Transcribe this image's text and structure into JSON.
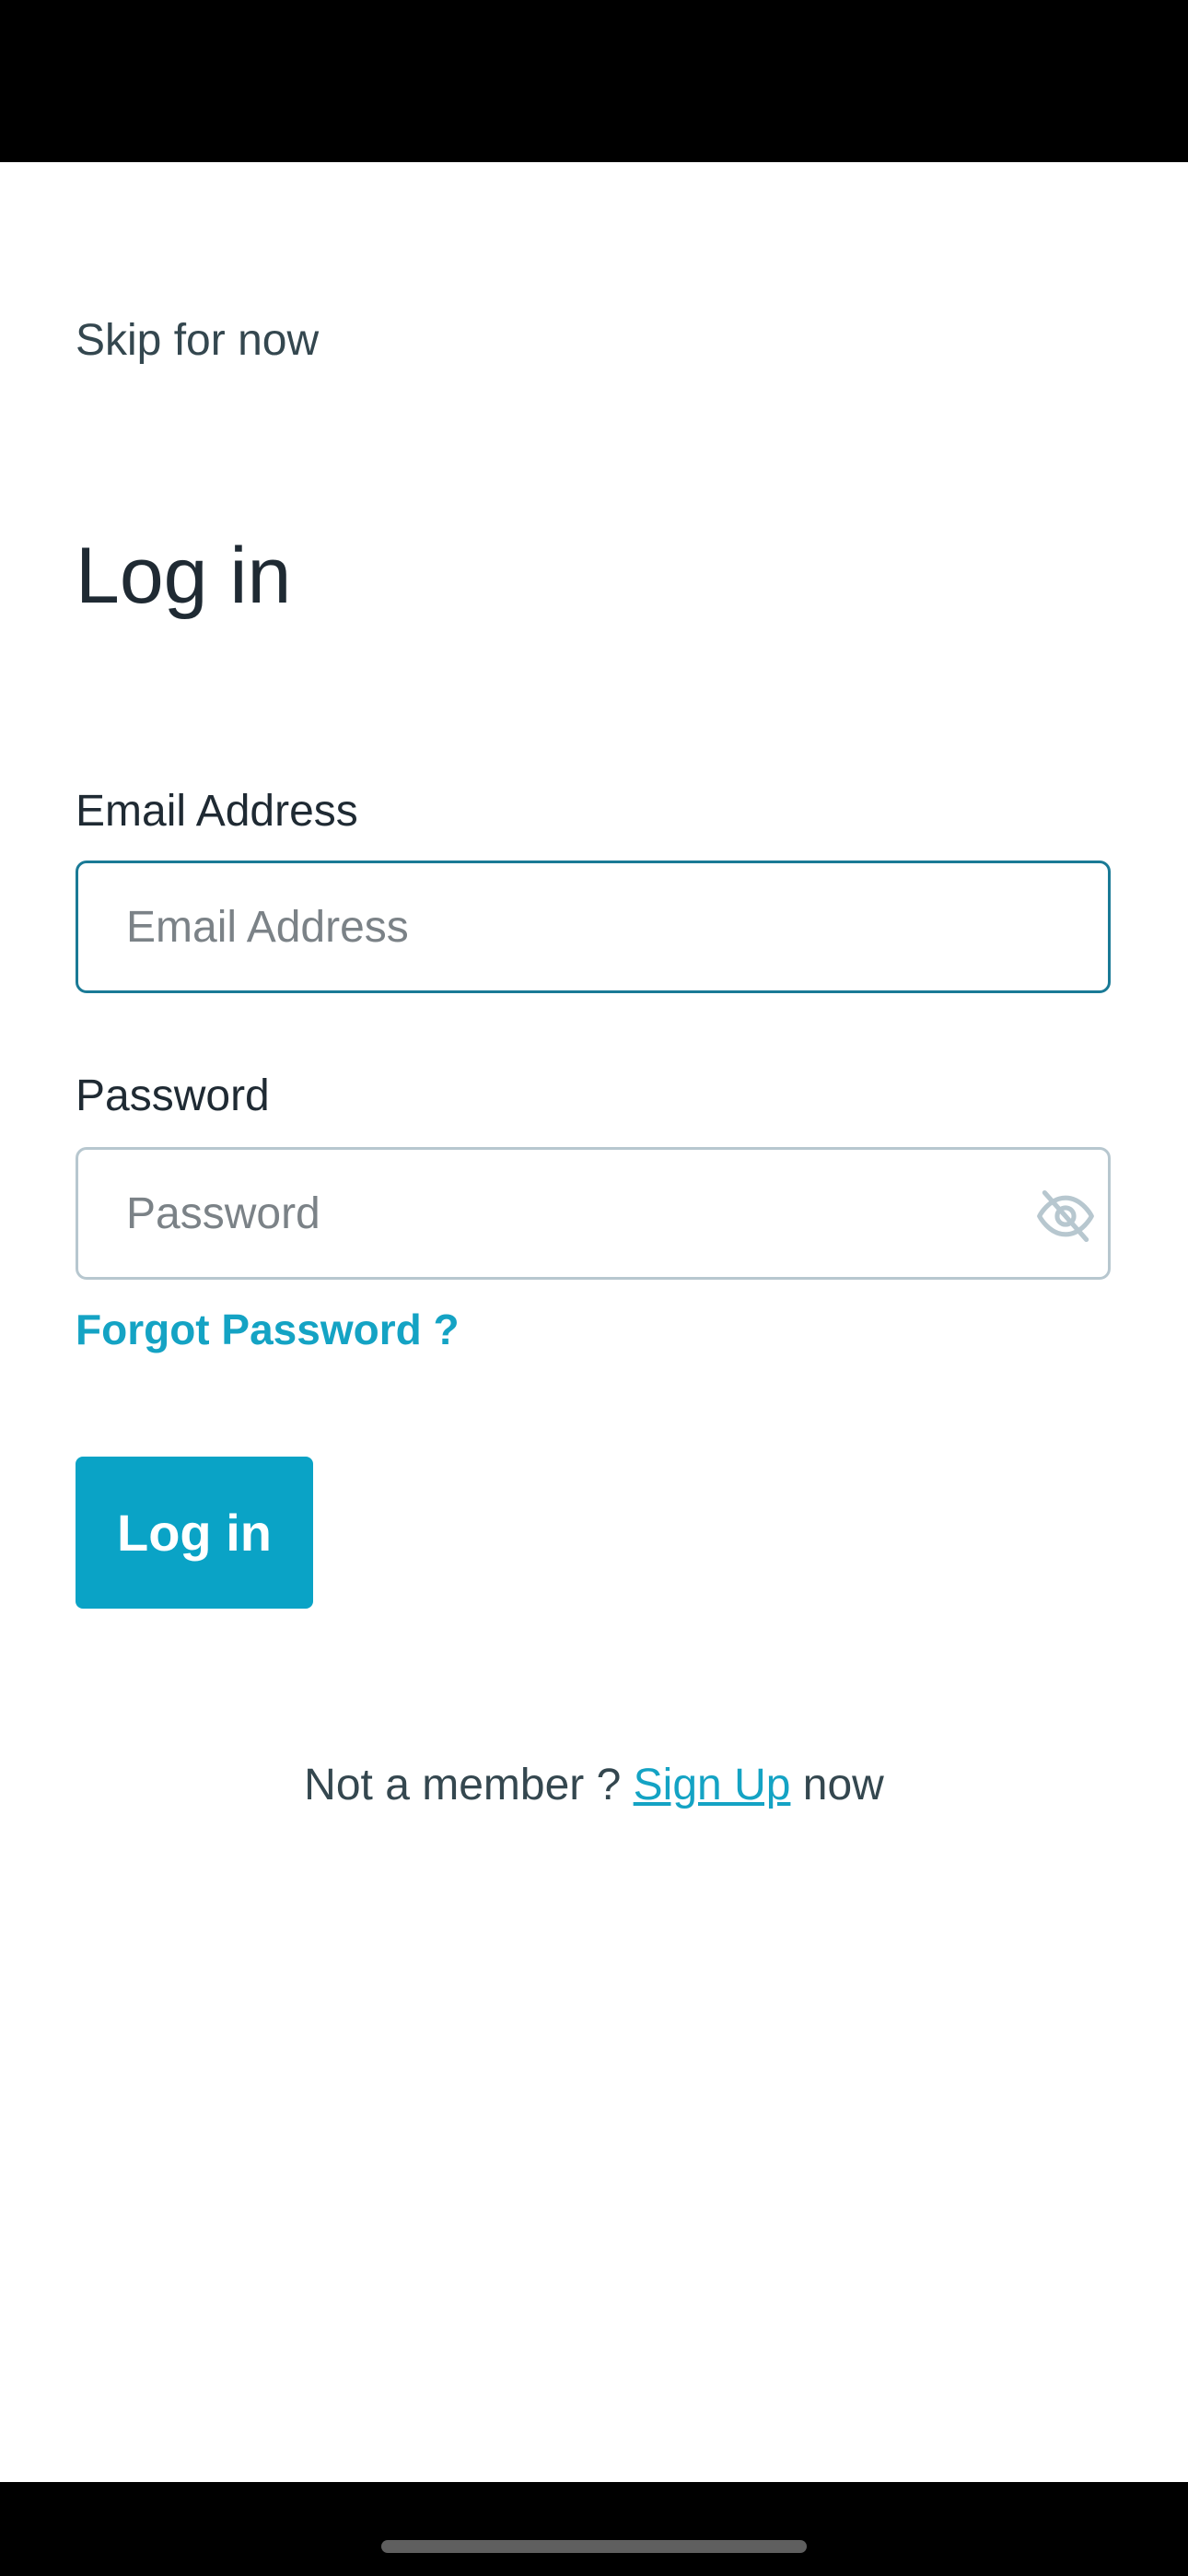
{
  "header": {
    "skip_label": "Skip for now"
  },
  "page": {
    "title": "Log in"
  },
  "form": {
    "email": {
      "label": "Email Address",
      "placeholder": "Email Address",
      "value": ""
    },
    "password": {
      "label": "Password",
      "placeholder": "Password",
      "value": "",
      "toggle_icon": "eye-off-icon"
    },
    "forgot_label": "Forgot Password ?",
    "submit_label": "Log in"
  },
  "footer": {
    "prefix": "Not a member ?",
    "signup_label": "Sign Up",
    "suffix": "now"
  },
  "colors": {
    "accent": "#0aa3c6",
    "link": "#14a3c4",
    "focus_border": "#1a7a96",
    "idle_border": "#b7c7cf",
    "text": "#1f2a33"
  }
}
